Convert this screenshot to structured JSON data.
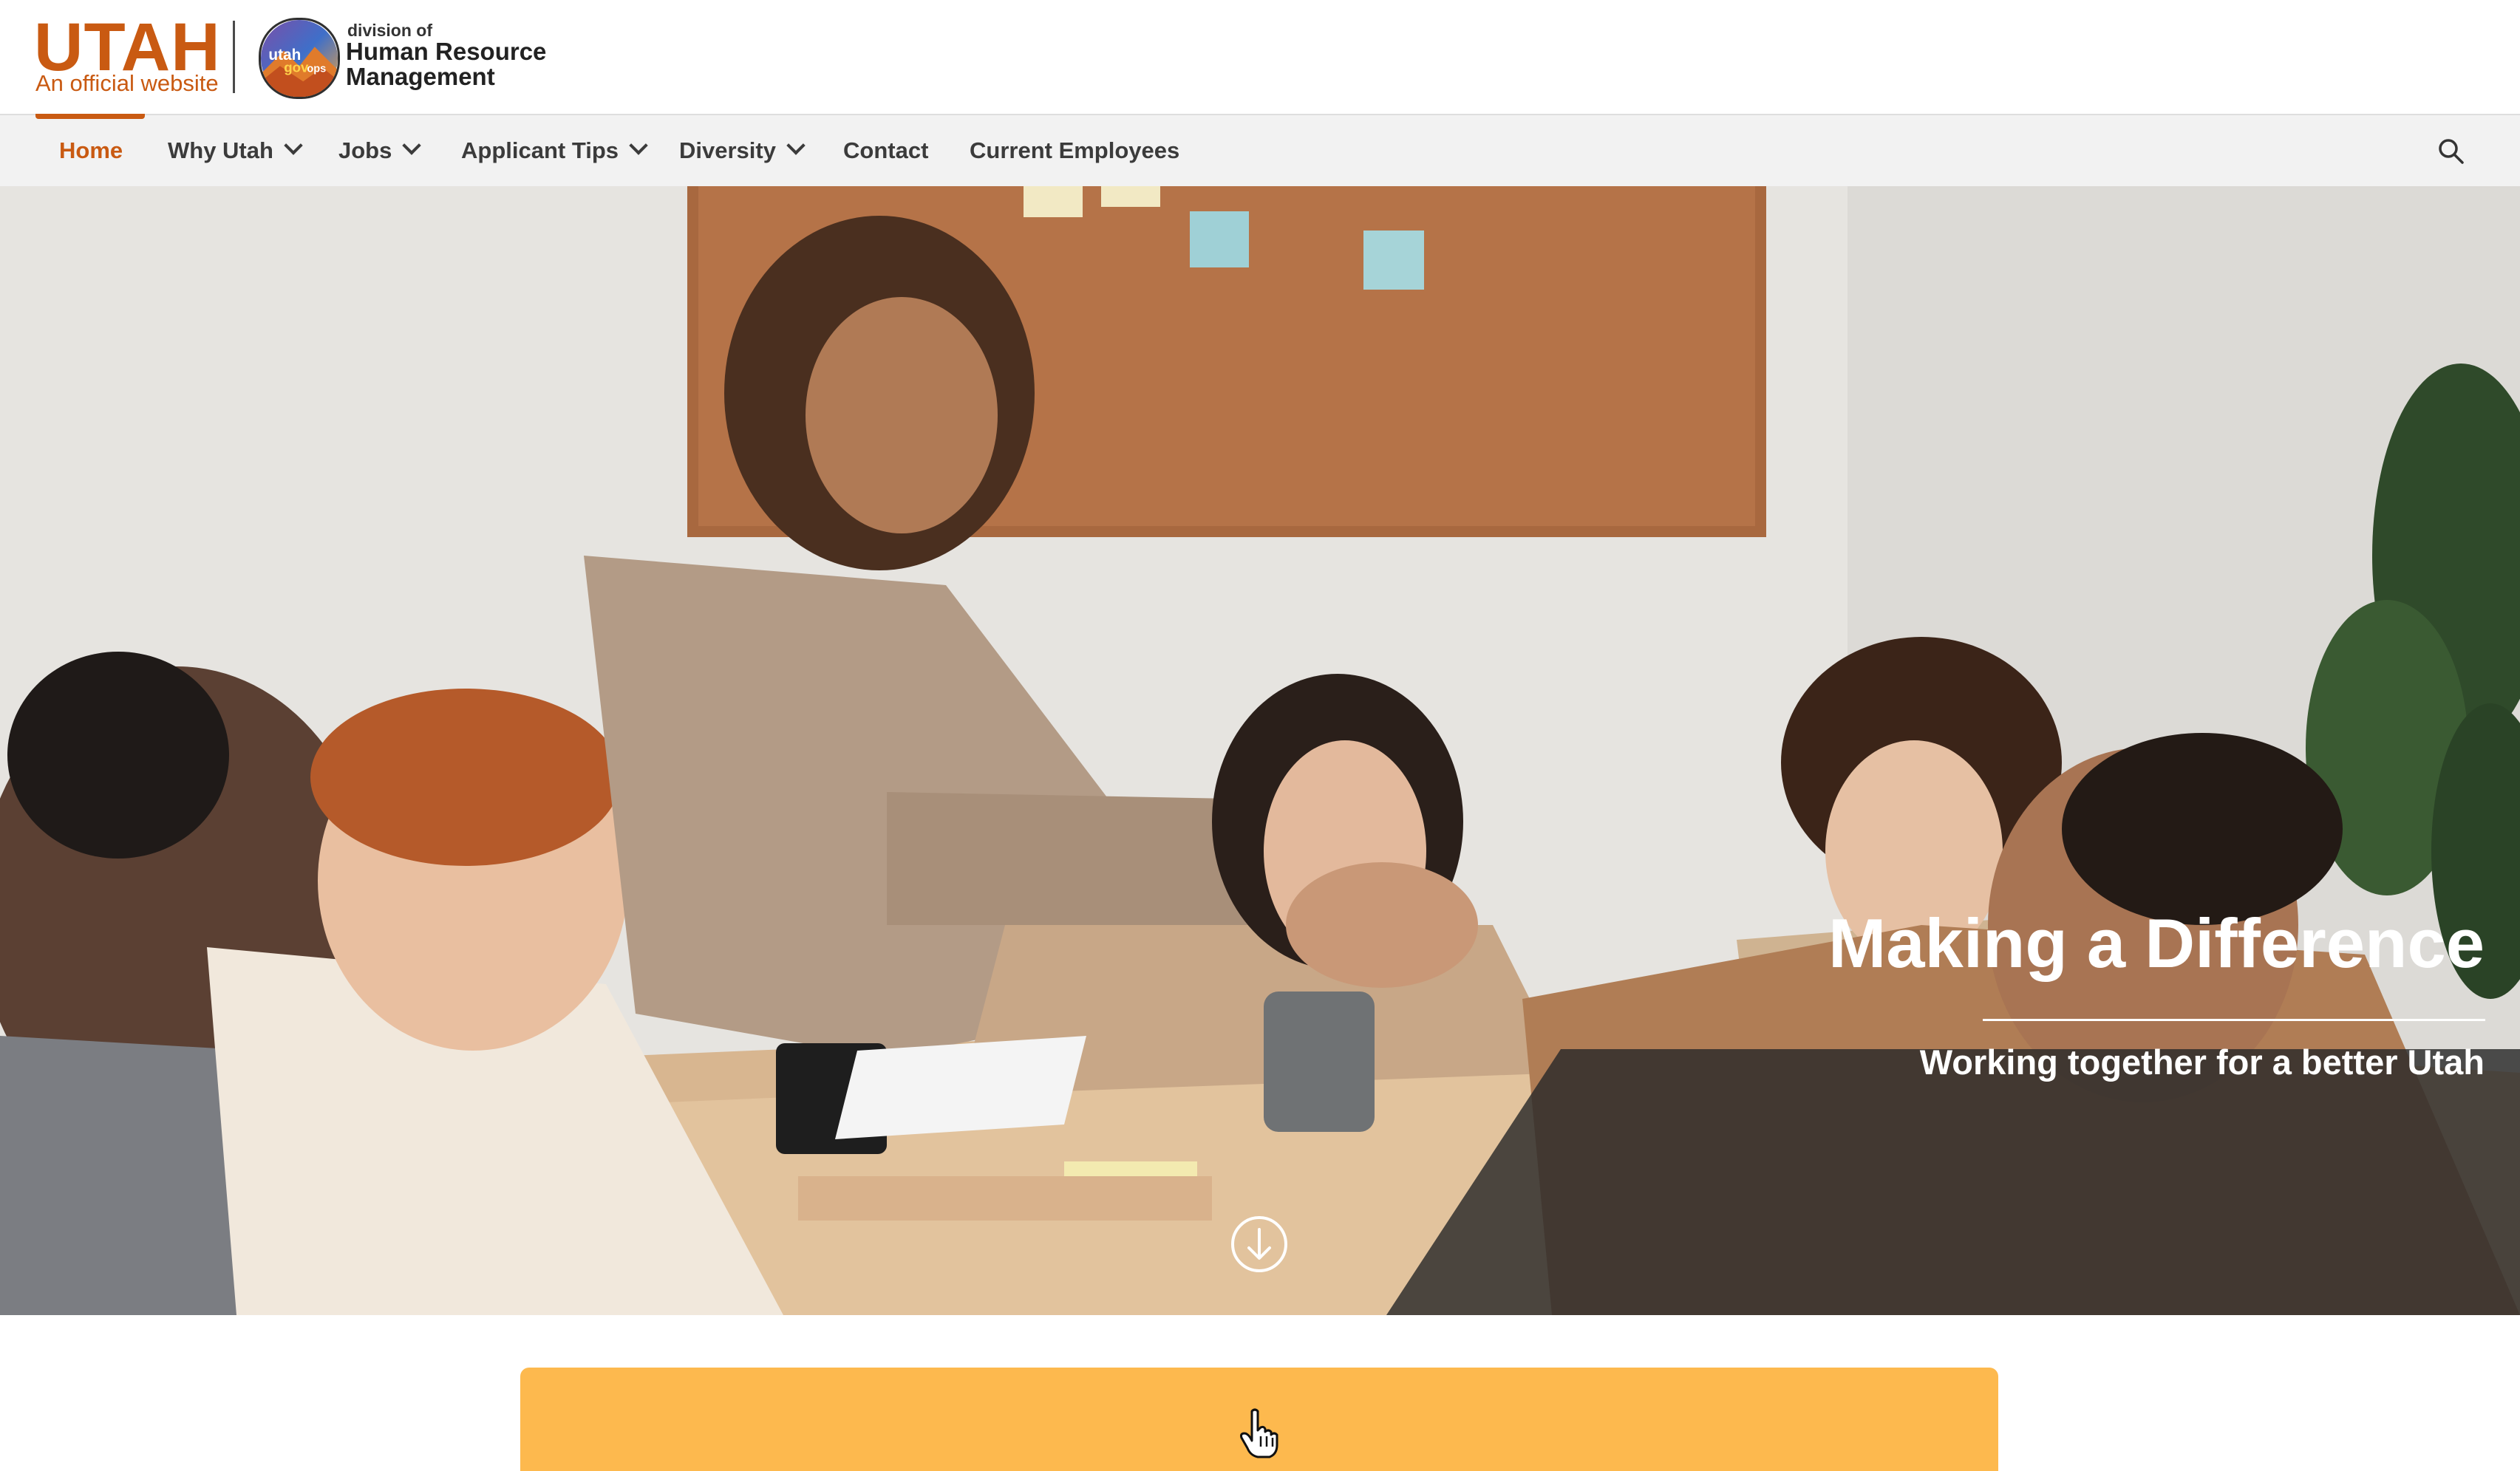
{
  "header": {
    "brand": "UTAH",
    "official": "An official website",
    "badge_text_1": "utah",
    "badge_text_2": "gov",
    "badge_text_3": "ops",
    "agency_prefix": "division of",
    "agency_line1": "Human Resource",
    "agency_line2": "Management"
  },
  "nav": {
    "items": [
      {
        "label": "Home",
        "active": true
      },
      {
        "label": "Why Utah",
        "dropdown": true
      },
      {
        "label": "Jobs",
        "dropdown": true
      },
      {
        "label": "Applicant Tips",
        "dropdown": true
      },
      {
        "label": "Diversity",
        "dropdown": true
      },
      {
        "label": "Contact"
      },
      {
        "label": "Current Employees"
      }
    ],
    "search_icon": "search-icon"
  },
  "hero": {
    "title": "Making a Difference",
    "subtitle": "Working together for a better Utah",
    "scroll_icon": "arrow-down-circle-icon"
  },
  "colors": {
    "brand": "#c95a12",
    "nav_bg": "#f2f2f2",
    "cta": "#fdb94e",
    "overlay": "#2a2a2a"
  }
}
